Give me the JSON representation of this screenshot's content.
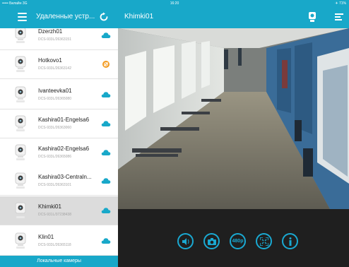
{
  "status_bar": {
    "carrier": "••••• Билайн 3G",
    "time": "16:20",
    "right": "✈ 71%"
  },
  "left_header": {
    "title": "Удаленные устр..."
  },
  "right_header": {
    "title": "Khimki01"
  },
  "cameras": [
    {
      "name": "Dzerzh01",
      "model": "DCS-933L/26363151",
      "status": "online"
    },
    {
      "name": "Hotkovo1",
      "model": "DCS-933L/26363142",
      "status": "offline"
    },
    {
      "name": "Ivanteevka01",
      "model": "DCS-933L/26365080",
      "status": "online"
    },
    {
      "name": "Kashira01-Engelsa6",
      "model": "DCS-933L/26363060",
      "status": "online"
    },
    {
      "name": "Kashira02-Engelsa6",
      "model": "DCS-933L/26365086",
      "status": "online"
    },
    {
      "name": "Kashira03-Centraln...",
      "model": "DCS-933L/26363101",
      "status": "online"
    },
    {
      "name": "Khimki01",
      "model": "DCS-931L/37238438",
      "status": "online",
      "selected": true
    },
    {
      "name": "Klin01",
      "model": "DCS-933L/26365118",
      "status": "online"
    }
  ],
  "list_footer": {
    "label": "Локальные камеры"
  },
  "controls": {
    "resolution": "480p"
  },
  "colors": {
    "accent": "#18a8c9",
    "offline": "#f39a1e",
    "control": "#1aa9d2"
  }
}
